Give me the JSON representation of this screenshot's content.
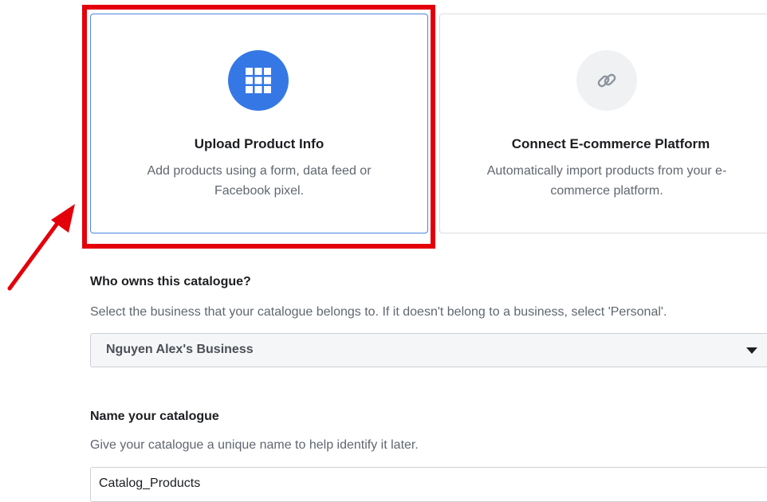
{
  "options": {
    "upload": {
      "title": "Upload Product Info",
      "description": "Add products using a form, data feed or Facebook pixel.",
      "icon": "grid-icon",
      "selected": true
    },
    "connect": {
      "title": "Connect E-commerce Platform",
      "description": "Automatically import products from your e-commerce platform.",
      "icon": "link-icon",
      "selected": false
    }
  },
  "owner": {
    "title": "Who owns this catalogue?",
    "description": "Select the business that your catalogue belongs to. If it doesn't belong to a business, select 'Personal'.",
    "selected_value": "Nguyen Alex's Business"
  },
  "name": {
    "title": "Name your catalogue",
    "description": "Give your catalogue a unique name to help identify it later.",
    "value": "Catalog_Products"
  },
  "colors": {
    "accent": "#3578e5",
    "highlight": "#e3000b"
  }
}
